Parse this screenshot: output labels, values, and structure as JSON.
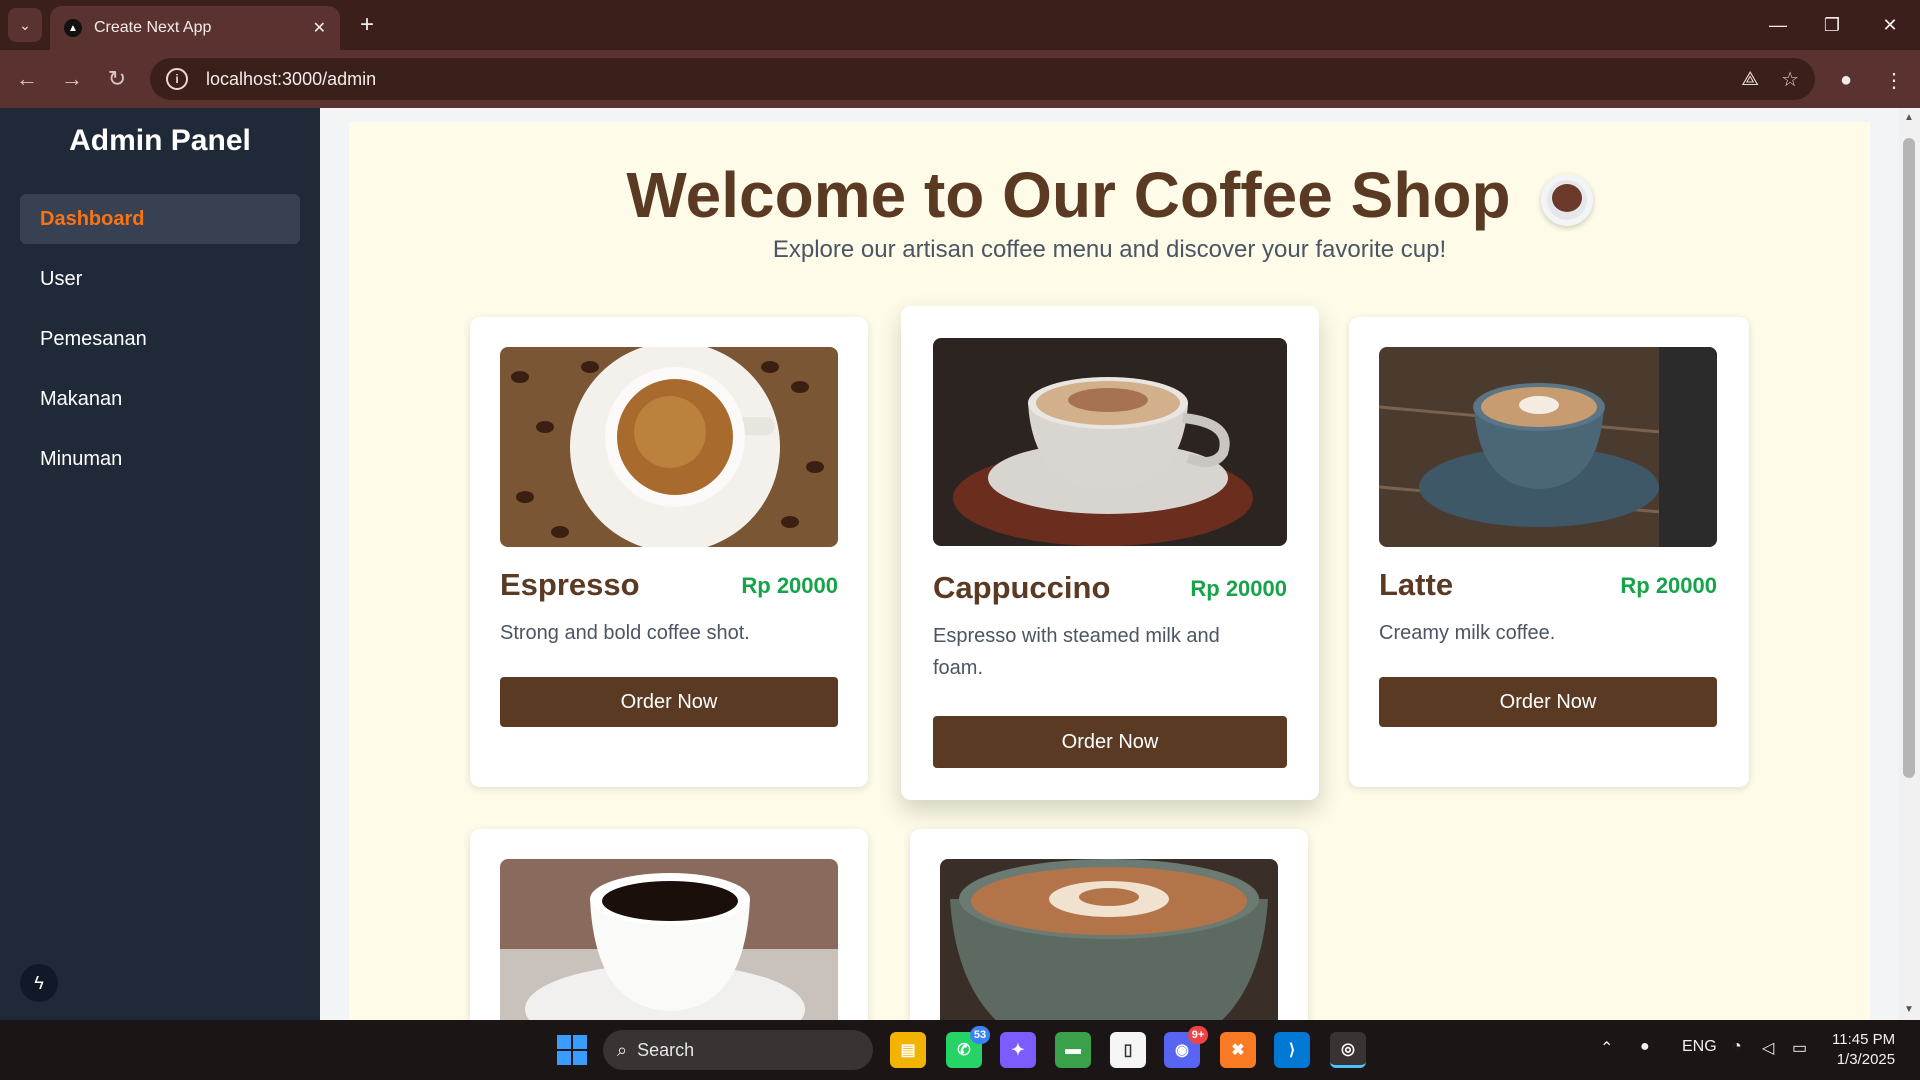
{
  "browser": {
    "tab_title": "Create Next App",
    "url": "localhost:3000/admin"
  },
  "sidebar": {
    "title": "Admin Panel",
    "items": [
      {
        "label": "Dashboard",
        "active": true
      },
      {
        "label": "User"
      },
      {
        "label": "Pemesanan"
      },
      {
        "label": "Makanan"
      },
      {
        "label": "Minuman"
      }
    ]
  },
  "main": {
    "heading": "Welcome to Our Coffee Shop",
    "subheading": "Explore our artisan coffee menu and discover your favorite cup!",
    "products": [
      {
        "name": "Espresso",
        "price": "Rp 20000",
        "description": "Strong and bold coffee shot.",
        "button": "Order Now"
      },
      {
        "name": "Cappuccino",
        "price": "Rp 20000",
        "description": "Espresso with steamed milk and foam.",
        "button": "Order Now"
      },
      {
        "name": "Latte",
        "price": "Rp 20000",
        "description": "Creamy milk coffee.",
        "button": "Order Now"
      }
    ]
  },
  "taskbar": {
    "search_placeholder": "Search",
    "whatsapp_badge": "53",
    "discord_badge": "9+",
    "language": "ENG",
    "time": "11:45 PM",
    "date": "1/3/2025"
  },
  "colors": {
    "sidebar_bg": "#1f2937",
    "active_nav": "#f97316",
    "brand_brown": "#5b3a24",
    "price_green": "#16a34a",
    "main_bg": "#fefce8"
  }
}
